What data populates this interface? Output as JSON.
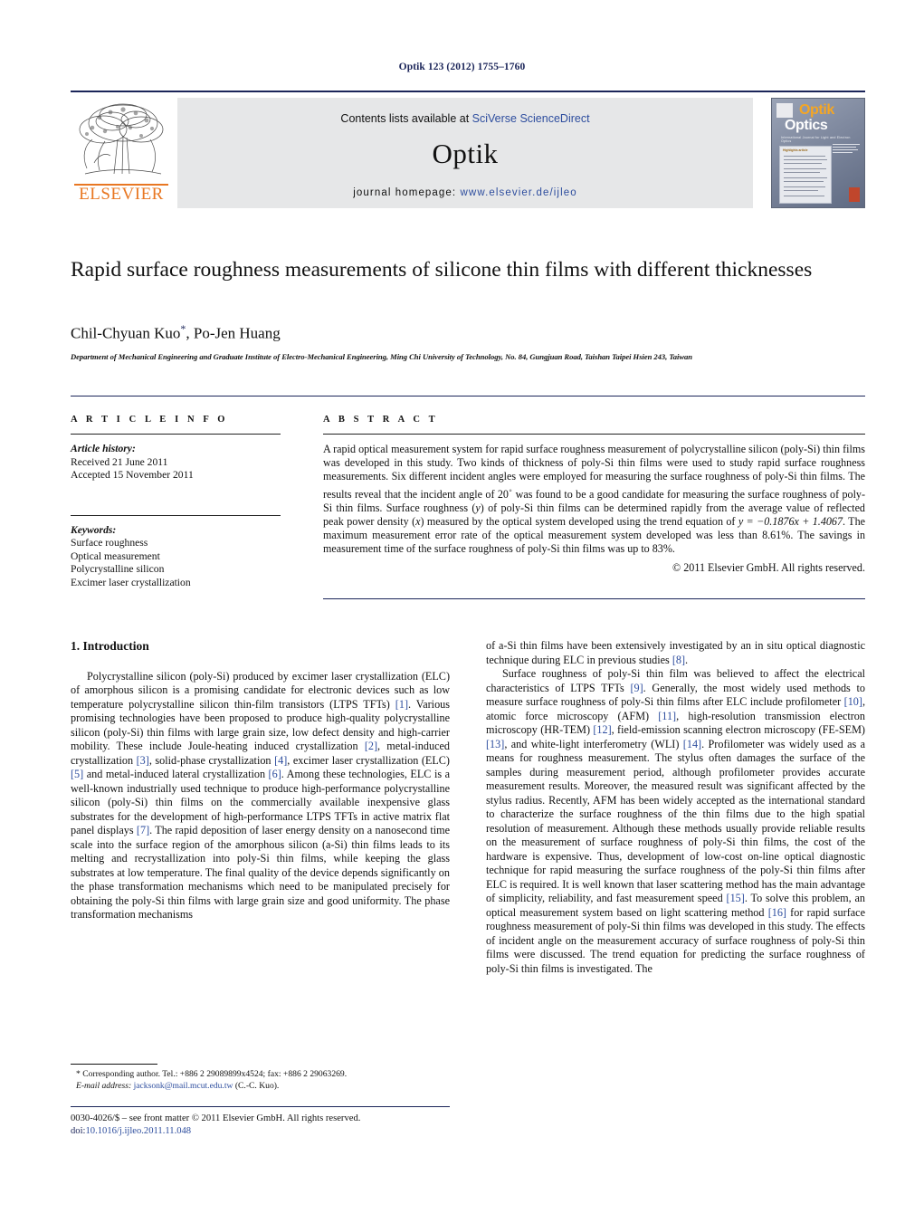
{
  "running_head": "Optik 123 (2012) 1755–1760",
  "masthead": {
    "contents_prefix": "Contents lists available at ",
    "contents_link": "SciVerse ScienceDirect",
    "journal_name": "Optik",
    "homepage_label": "journal homepage:",
    "homepage_url": "www.elsevier.de/ijleo",
    "publisher_logo_text": "ELSEVIER",
    "cover": {
      "title_primary": "Optik",
      "title_secondary": "Optics",
      "subtitle": "International Journal for Light and Electron Optics",
      "panel_title": "Highlights article",
      "publisher_mark": "ELSEVIER"
    }
  },
  "article": {
    "title": "Rapid surface roughness measurements of silicone thin films with different thicknesses",
    "authors": "Chil-Chyuan Kuo",
    "authors_rest": ", Po-Jen Huang",
    "corresponding_marker": "*",
    "affiliation": "Department of Mechanical Engineering and Graduate Institute of Electro-Mechanical Engineering, Ming Chi University of Technology, No. 84, Gungjuan Road, Taishan Taipei Hsien 243, Taiwan"
  },
  "article_info": {
    "heading": "A R T I C L E   I N F O",
    "history_label": "Article history:",
    "received": "Received 21 June 2011",
    "accepted": "Accepted 15 November 2011",
    "keywords_label": "Keywords:",
    "keywords": [
      "Surface roughness",
      "Optical measurement",
      "Polycrystalline silicon",
      "Excimer laser crystallization"
    ]
  },
  "abstract": {
    "heading": "A B S T R A C T",
    "part1": "A rapid optical measurement system for rapid surface roughness measurement of polycrystalline silicon (poly-Si) thin films was developed in this study. Two kinds of thickness of poly-Si thin films were used to study rapid surface roughness measurements. Six different incident angles were employed for measuring the surface roughness of poly-Si thin films. The results reveal that the incident angle of 20",
    "degree": "◦",
    "part2": " was found to be a good candidate for measuring the surface roughness of poly-Si thin films. Surface roughness (",
    "var_y": "y",
    "part3": ") of poly-Si thin films can be determined rapidly from the average value of reflected peak power density (",
    "var_x": "x",
    "part4": ") measured by the optical system developed using the trend equation of ",
    "equation": "y = −0.1876x + 1.4067",
    "part5": ". The maximum measurement error rate of the optical measurement system developed was less than 8.61%. The savings in measurement time of the surface roughness of poly-Si thin films was up to 83%.",
    "copyright": "© 2011 Elsevier GmbH. All rights reserved."
  },
  "body": {
    "section_heading": "1. Introduction",
    "left_p1": "Polycrystalline silicon (poly-Si) produced by excimer laser crystallization (ELC) of amorphous silicon is a promising candidate for electronic devices such as low temperature polycrystalline silicon thin-film transistors (LTPS TFTs) [1]. Various promising technologies have been proposed to produce high-quality polycrystalline silicon (poly-Si) thin films with large grain size, low defect density and high-carrier mobility. These include Joule-heating induced crystallization [2], metal-induced crystallization [3], solid-phase crystallization [4], excimer laser crystallization (ELC) [5] and metal-induced lateral crystallization [6]. Among these technologies, ELC is a well-known industrially used technique to produce high-performance polycrystalline silicon (poly-Si) thin films on the commercially available inexpensive glass substrates for the development of high-performance LTPS TFTs in active matrix flat panel displays [7]. The rapid deposition of laser energy density on a nanosecond time scale into the surface region of the amorphous silicon (a-Si) thin films leads to its melting and recrystallization into poly-Si thin films, while keeping the glass substrates at low temperature. The final quality of the device depends significantly on the phase transformation mechanisms which need to be manipulated precisely for obtaining the poly-Si thin films with large grain size and good uniformity. The phase transformation mechanisms",
    "right_p1": "of a-Si thin films have been extensively investigated by an in situ optical diagnostic technique during ELC in previous studies [8].",
    "right_p2": "Surface roughness of poly-Si thin film was believed to affect the electrical characteristics of LTPS TFTs [9]. Generally, the most widely used methods to measure surface roughness of poly-Si thin films after ELC include profilometer [10], atomic force microscopy (AFM) [11], high-resolution transmission electron microscopy (HR-TEM) [12], field-emission scanning electron microscopy (FE-SEM) [13], and white-light interferometry (WLI) [14]. Profilometer was widely used as a means for roughness measurement. The stylus often damages the surface of the samples during measurement period, although profilometer provides accurate measurement results. Moreover, the measured result was significant affected by the stylus radius. Recently, AFM has been widely accepted as the international standard to characterize the surface roughness of the thin films due to the high spatial resolution of measurement. Although these methods usually provide reliable results on the measurement of surface roughness of poly-Si thin films, the cost of the hardware is expensive. Thus, development of low-cost on-line optical diagnostic technique for rapid measuring the surface roughness of the poly-Si thin films after ELC is required. It is well known that laser scattering method has the main advantage of simplicity, reliability, and fast measurement speed [15]. To solve this problem, an optical measurement system based on light scattering method [16] for rapid surface roughness measurement of poly-Si thin films was developed in this study. The effects of incident angle on the measurement accuracy of surface roughness of poly-Si thin films were discussed. The trend equation for predicting the surface roughness of poly-Si thin films is investigated. The"
  },
  "footnote": {
    "marker": "*",
    "corresponding": "Corresponding author. Tel.: +886 2 29089899x4524; fax: +886 2 29063269.",
    "email_label": "E-mail address:",
    "email": "jacksonk@mail.mcut.edu.tw",
    "email_suffix": " (C.-C. Kuo)."
  },
  "footer": {
    "issn_line": "0030-4026/$ – see front matter © 2011 Elsevier GmbH. All rights reserved.",
    "doi_label": "doi:",
    "doi_value": "10.1016/j.ijleo.2011.11.048"
  },
  "colors": {
    "link": "#2d4d9e",
    "navy": "#1b2559",
    "elsevier_orange": "#e87722",
    "masthead_bg": "#e6e7e8"
  }
}
